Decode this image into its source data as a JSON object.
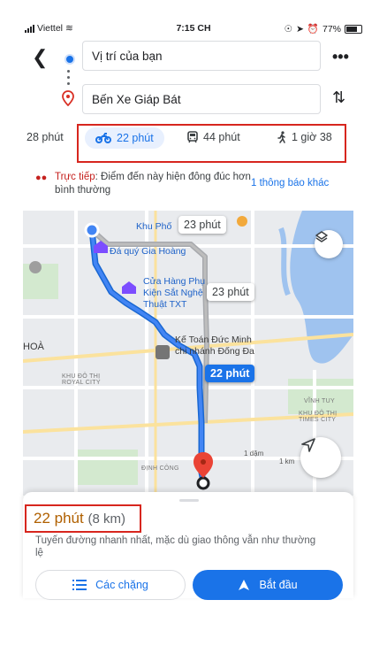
{
  "status_bar": {
    "carrier": "Viettel",
    "time": "7:15 CH",
    "battery": "77%"
  },
  "search": {
    "origin": "Vị trí của bạn",
    "destination": "Bến Xe Giáp Bát"
  },
  "modes": [
    {
      "icon": "car-icon",
      "label": "28 phút"
    },
    {
      "icon": "motorbike-icon",
      "label": "22 phút",
      "active": true
    },
    {
      "icon": "transit-icon",
      "label": "44 phút"
    },
    {
      "icon": "walk-icon",
      "label": "1 giờ 38"
    }
  ],
  "live_alert": {
    "prefix": "Trực tiếp",
    "text": ": Điểm đến này hiện đông đúc hơn bình thường",
    "more_link": "1 thông báo khác"
  },
  "map": {
    "labels": {
      "khu_pho": "Khu Phố",
      "da_quy": "Đá quý Gia Hoàng",
      "cua_hang": "Cửa Hàng Phụ Kiện Sắt Nghệ Thuật TXT",
      "ke_toan": "Kế Toán Đức Minh chi nhánh Đống Đa",
      "hoa": "HOÀ",
      "khu_do_thi_royal": "KHU ĐÔ THỊ ROYAL CITY",
      "vinh_tuy": "VĨNH TUY",
      "times_city": "KHU ĐÔ THỊ TIMES CITY",
      "dinh_cong": "ĐỊNH CÔNG",
      "scale": "1 dặm",
      "scale_km": "1 km"
    },
    "bubbles": {
      "alt1": "23 phút",
      "alt2": "23 phút",
      "primary": "22 phút"
    }
  },
  "summary": {
    "duration": "22 phút",
    "distance": "(8 km)",
    "description": "Tuyến đường nhanh nhất, mặc dù giao thông vẫn như thường lệ"
  },
  "buttons": {
    "steps": "Các chặng",
    "start": "Bắt đầu"
  },
  "colors": {
    "accent": "#1a73e8",
    "highlight_box": "#d7261e",
    "route": "#4285f4",
    "eta": "#b06000"
  }
}
